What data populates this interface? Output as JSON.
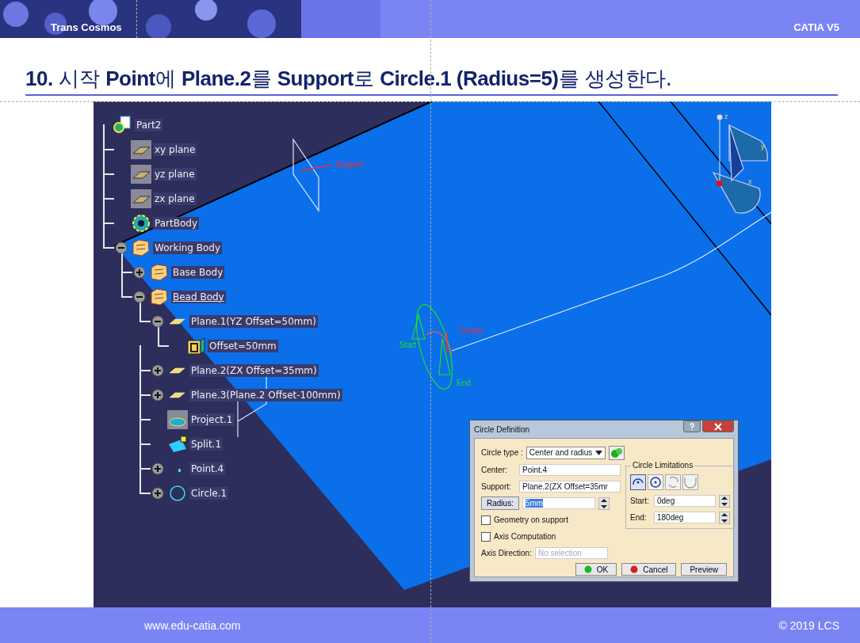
{
  "header": {
    "company": "Trans Cosmos",
    "product": "CATIA V5"
  },
  "title": "**10.** 시작 **Point**에 **Plane.2**를 **Support**로 **Circle.1 (Radius=5)**를 생성한다.",
  "tree": [
    {
      "label": "Part2",
      "kind": "part",
      "current": false,
      "children": [
        {
          "label": "xy plane",
          "kind": "ref-plane",
          "current": false
        },
        {
          "label": "yz plane",
          "kind": "ref-plane",
          "current": false
        },
        {
          "label": "zx plane",
          "kind": "ref-plane",
          "current": false
        },
        {
          "label": "PartBody",
          "kind": "body",
          "current": false
        },
        {
          "label": "Working Body",
          "kind": "geoset",
          "current": false,
          "expanded": true,
          "children": [
            {
              "label": "Base Body",
              "kind": "geoset",
              "current": false,
              "expanded": false
            },
            {
              "label": "Bead Body",
              "kind": "geoset",
              "current": true,
              "expanded": true,
              "children": [
                {
                  "label": "Plane.1(YZ Offset=50mm)",
                  "kind": "plane",
                  "current": false,
                  "expanded": true,
                  "children": [
                    {
                      "label": "Offset=50mm",
                      "kind": "parameter",
                      "current": false
                    }
                  ]
                },
                {
                  "label": "Plane.2(ZX Offset=35mm)",
                  "kind": "plane",
                  "current": false,
                  "expanded": false
                },
                {
                  "label": "Plane.3(Plane.2 Offset-100mm)",
                  "kind": "plane",
                  "current": false,
                  "expanded": false
                },
                {
                  "label": "Project.1",
                  "kind": "projection",
                  "current": false
                },
                {
                  "label": "Split.1",
                  "kind": "split",
                  "current": false
                },
                {
                  "label": "Point.4",
                  "kind": "point",
                  "current": false,
                  "expanded": false
                },
                {
                  "label": "Circle.1",
                  "kind": "circle",
                  "current": false,
                  "expanded": false
                }
              ]
            }
          ]
        }
      ]
    }
  ],
  "viewport_labels": [
    {
      "text": "Support",
      "color": "#ff2a2a"
    },
    {
      "text": "Center",
      "color": "#ff2a2a"
    },
    {
      "text": "Start",
      "color": "#22dd22"
    },
    {
      "text": "End",
      "color": "#22dd22"
    }
  ],
  "compass_axes": [
    "z",
    "y",
    "x"
  ],
  "dialog": {
    "title": "Circle Definition",
    "circle_type_label": "Circle type :",
    "circle_type": "Center and radius",
    "center_label": "Center:",
    "center": "Point.4",
    "support_label": "Support:",
    "support": "Plane.2(ZX Offset=35mr",
    "radius_button": "Radius:",
    "radius": "5mm",
    "checkboxes": [
      {
        "label": "Geometry on support",
        "checked": false
      },
      {
        "label": "Axis Computation",
        "checked": false
      }
    ],
    "axis_direction_label": "Axis Direction:",
    "axis_direction_placeholder": "No selection",
    "limitations_title": "Circle Limitations",
    "limitation_modes": [
      {
        "kind": "arc",
        "selected": true
      },
      {
        "kind": "full",
        "selected": false
      },
      {
        "kind": "trimmed",
        "selected": false
      },
      {
        "kind": "complement",
        "selected": false
      }
    ],
    "start_label": "Start:",
    "start": "0deg",
    "end_label": "End:",
    "end": "180deg",
    "buttons": [
      {
        "label": "OK",
        "kind": "ok"
      },
      {
        "label": "Cancel",
        "kind": "cancel"
      },
      {
        "label": "Preview",
        "kind": "plain"
      }
    ]
  },
  "footer": {
    "url": "www.edu-catia.com",
    "copyright": "© 2019 LCS"
  }
}
